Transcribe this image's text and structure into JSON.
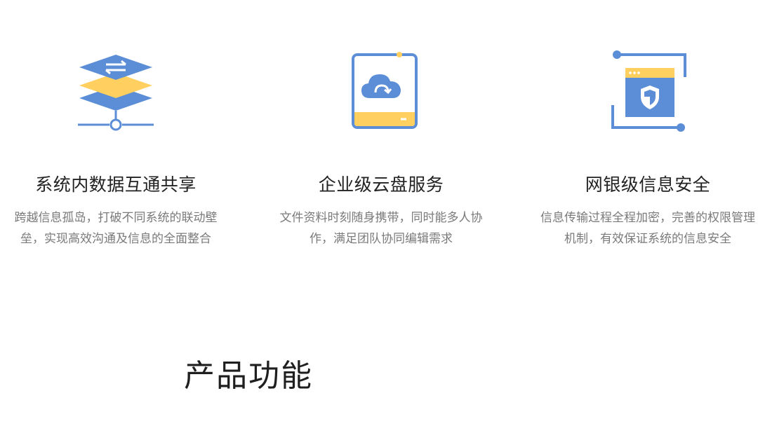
{
  "features": [
    {
      "icon": "data-exchange-layers-icon",
      "title": "系统内数据互通共享",
      "description": "跨越信息孤岛，打破不同系统的联动壁垒，实现高效沟通及信息的全面整合"
    },
    {
      "icon": "cloud-drive-icon",
      "title": "企业级云盘服务",
      "description": "文件资料时刻随身携带，同时能多人协作，满足团队协同编辑需求"
    },
    {
      "icon": "security-shield-icon",
      "title": "网银级信息安全",
      "description": "信息传输过程全程加密，完善的权限管理机制，有效保证系统的信息安全"
    }
  ],
  "section": {
    "title": "产品功能"
  },
  "colors": {
    "blue": "#5b8ed6",
    "yellow": "#ffd060",
    "title_text": "#222222",
    "desc_text": "#7a7a7a"
  }
}
